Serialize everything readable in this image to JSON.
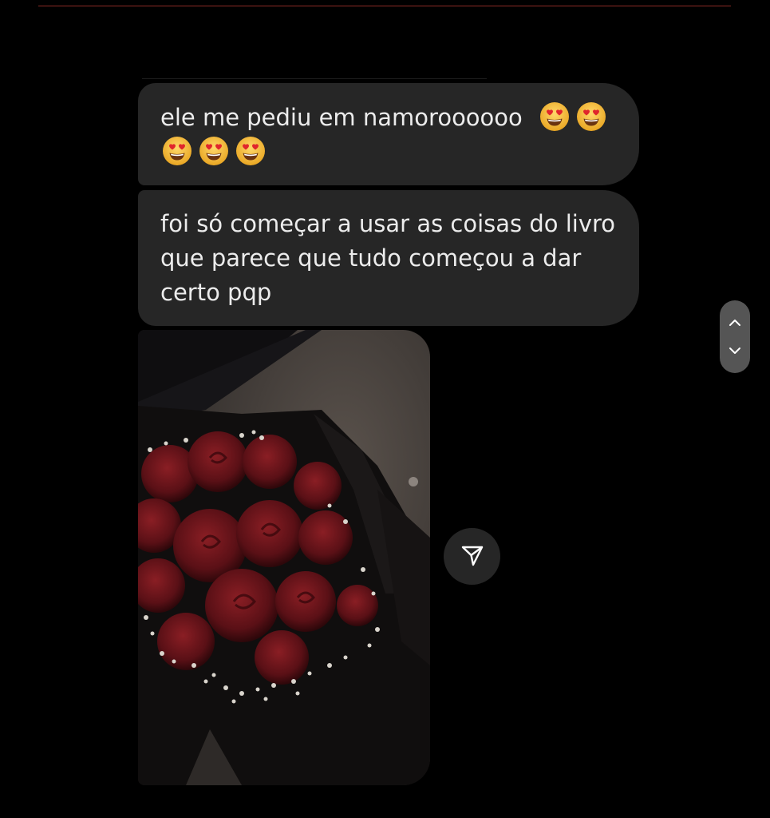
{
  "conversation": {
    "messages": [
      {
        "text": "ele me pediu em namoroooooo",
        "emojis": [
          "smiling-face-with-heart-eyes",
          "smiling-face-with-heart-eyes",
          "smiling-face-with-heart-eyes",
          "smiling-face-with-heart-eyes",
          "smiling-face-with-heart-eyes"
        ]
      },
      {
        "text": "foi só começar a usar as coisas do livro que parece que tudo começou a dar certo pqp"
      }
    ],
    "attachment": {
      "type": "photo",
      "subject": "bouquet-of-red-roses"
    }
  },
  "actions": {
    "share_icon": "paper-plane-icon"
  },
  "scroller": {
    "up_icon": "chevron-up-icon",
    "down_icon": "chevron-down-icon"
  },
  "colors": {
    "background": "#000000",
    "bubble": "#262626",
    "text": "#ececec",
    "accent_rule": "#8a2a25",
    "scroll_pill": "#555555"
  }
}
